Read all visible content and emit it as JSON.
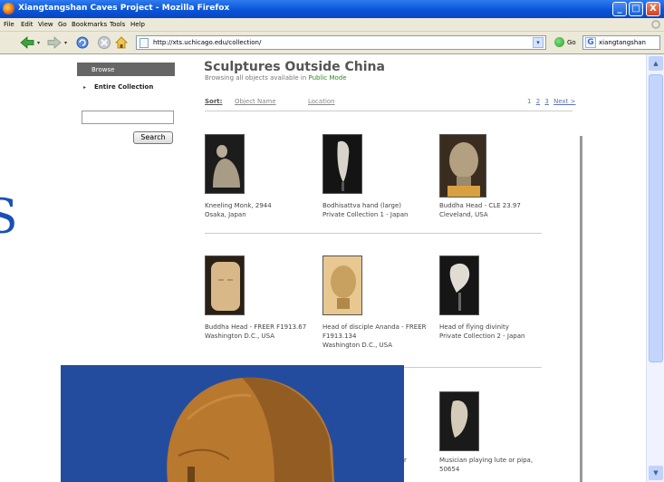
{
  "window": {
    "title": "Xiangtangshan Caves Project - Mozilla Firefox",
    "buttons": [
      "_",
      "□",
      "X"
    ]
  },
  "menu": [
    "File",
    "Edit",
    "View",
    "Go",
    "Bookmarks",
    "Tools",
    "Help"
  ],
  "nav": {
    "url": "http://xts.uchicago.edu/collection/",
    "go_label": "Go",
    "search_query": "xiangtangshan"
  },
  "sidebar": {
    "header": "Browse",
    "item": "Entire Collection",
    "search_value": "",
    "search_button": "Search"
  },
  "bleed_glyph": "S",
  "main": {
    "title": "Sculptures Outside China",
    "subtitle_prefix": "Browsing all objects available in ",
    "subtitle_mode": "Public Mode",
    "sort_label": "Sort:",
    "sort_options": [
      "Object Name",
      "Location"
    ],
    "pager": {
      "current": "1",
      "pages": [
        "2",
        "3"
      ],
      "next": "Next >"
    }
  },
  "items": [
    {
      "name": "Kneeling Monk, 2944",
      "location": "Osaka, Japan",
      "tone": "#a89c86"
    },
    {
      "name": "Bodhisattva hand (large)",
      "location": "Private Collection 1 - Japan",
      "tone": "#d8d4cc"
    },
    {
      "name": "Buddha Head - CLE 23.97",
      "location": "Cleveland, USA",
      "tone": "#b2a080"
    },
    {
      "name": "Buddha Head - FREER F1913.67",
      "location": "Washington D.C., USA",
      "tone": "#d8b888"
    },
    {
      "name": "Head of disciple Ananda - FREER F1913.134",
      "location": "Washington D.C., USA",
      "tone": "#c8a060"
    },
    {
      "name": "Head of flying divinity",
      "location": "Private Collection 2 - Japan",
      "tone": "#e0dcd4"
    },
    {
      "name": "Musician playing lute or pipa, 50654",
      "location": "",
      "tone": "#d4ccb8"
    }
  ],
  "partial_caption_glyph": "r",
  "overlay": {
    "sky": "#234c9f",
    "stone": "#b8782e"
  }
}
